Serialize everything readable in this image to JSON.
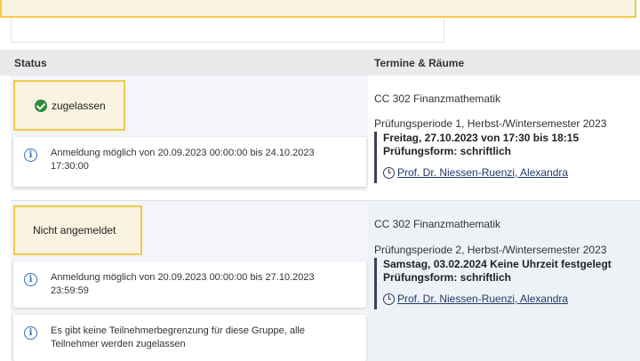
{
  "header": {
    "status_label": "Status",
    "termine_label": "Termine & Räume"
  },
  "rows": [
    {
      "status": "zugelassen",
      "status_icon": "check-circle-icon",
      "info_cards": [
        "Anmeldung möglich von 20.09.2023 00:00:00 bis 24.10.2023 17:30:00"
      ],
      "course": "CC 302 Finanzmathematik",
      "period": "Prüfungsperiode 1, Herbst-/Wintersemester 2023",
      "datetime": "Freitag, 27.10.2023 von 17:30 bis 18:15",
      "form": "Prüfungsform: schriftlich",
      "examiner": "Prof. Dr. Niessen-Ruenzi, Alexandra"
    },
    {
      "status": "Nicht angemeldet",
      "info_cards": [
        "Anmeldung möglich von 20.09.2023 00:00:00 bis 27.10.2023 23:59:59",
        "Es gibt keine Teilnehmerbegrenzung für diese Gruppe, alle Teilnehmer werden zugelassen"
      ],
      "course": "CC 302 Finanzmathematik",
      "period": "Prüfungsperiode 2, Herbst-/Wintersemester 2023",
      "datetime": "Samstag, 03.02.2024 Keine Uhrzeit festgelegt",
      "form": "Prüfungsform: schriftlich",
      "examiner": "Prof. Dr. Niessen-Ruenzi, Alexandra"
    }
  ],
  "colors": {
    "highlight_border": "#f2c94c",
    "highlight_bg": "#fbf3e2",
    "success": "#2e8b3a",
    "info": "#2f6fb2"
  }
}
